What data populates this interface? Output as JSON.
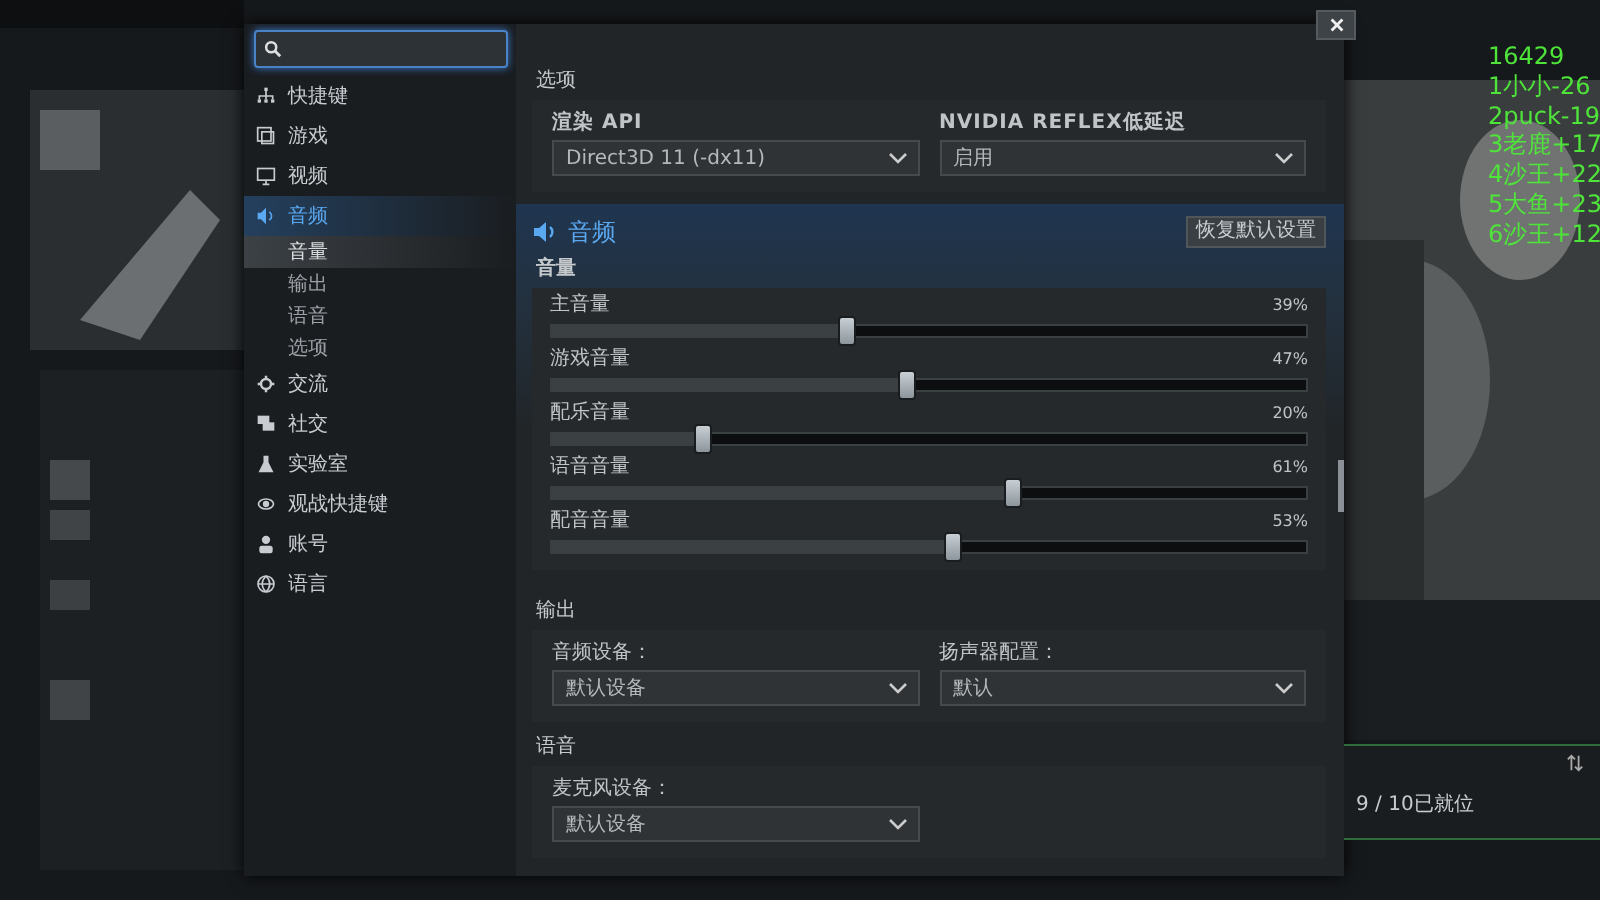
{
  "sidebar": {
    "items": [
      {
        "label": "快捷键",
        "selected": false
      },
      {
        "label": "游戏",
        "selected": false
      },
      {
        "label": "视频",
        "selected": false
      },
      {
        "label": "音频",
        "selected": true,
        "expanded": true,
        "children": [
          {
            "label": "音量",
            "selected": true
          },
          {
            "label": "输出",
            "selected": false
          },
          {
            "label": "语音",
            "selected": false
          },
          {
            "label": "选项",
            "selected": false
          }
        ]
      },
      {
        "label": "交流",
        "selected": false
      },
      {
        "label": "社交",
        "selected": false
      },
      {
        "label": "实验室",
        "selected": false
      },
      {
        "label": "观战快捷键",
        "selected": false
      },
      {
        "label": "账号",
        "selected": false
      },
      {
        "label": "语言",
        "selected": false
      }
    ]
  },
  "options": {
    "title": "选项",
    "fields": [
      {
        "label": "渲染 API",
        "value": "Direct3D 11 (-dx11)"
      },
      {
        "label": "NVIDIA REFLEX低延迟",
        "value": "启用"
      }
    ]
  },
  "audio": {
    "title": "音频",
    "reset_button": "恢复默认设置"
  },
  "volume": {
    "title": "音量",
    "sliders": [
      {
        "label": "主音量",
        "reading": "39%",
        "level": 0.39
      },
      {
        "label": "游戏音量",
        "reading": "47%",
        "level": 0.47
      },
      {
        "label": "配乐音量",
        "reading": "20%",
        "level": 0.2
      },
      {
        "label": "语音音量",
        "reading": "61%",
        "level": 0.61
      },
      {
        "label": "配音音量",
        "reading": "53%",
        "level": 0.53
      }
    ]
  },
  "output": {
    "title": "输出",
    "fields": [
      {
        "label": "音频设备：",
        "value": "默认设备"
      },
      {
        "label": "扬声器配置：",
        "value": "默认"
      }
    ]
  },
  "voice": {
    "title": "语音",
    "fields": [
      {
        "label": "麦克风设备：",
        "value": "默认设备"
      }
    ]
  },
  "overlay_lines": [
    "16429",
    "1小小-26",
    "2puck-19",
    "3老鹿+17",
    "4沙王+22",
    "5大鱼+23",
    "6沙王+12"
  ],
  "ready_panel": {
    "status": "9 / 10已就位"
  }
}
